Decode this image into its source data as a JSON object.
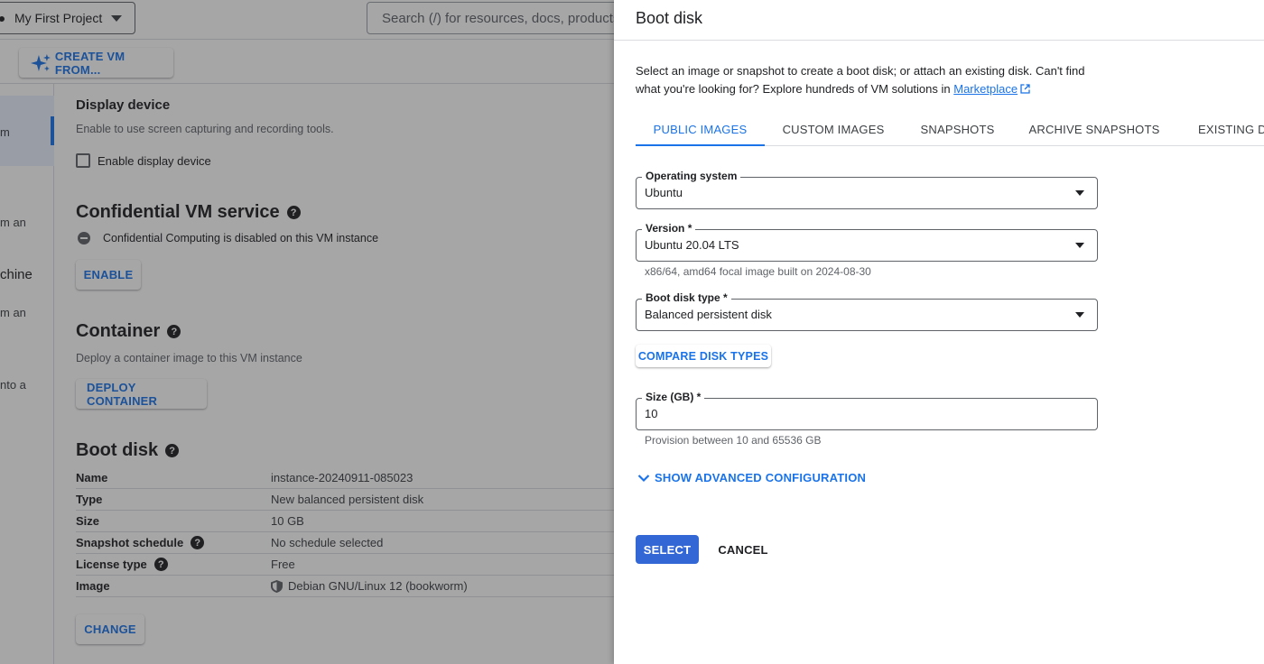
{
  "topbar": {
    "project_name": "My First Project",
    "search_placeholder": "Search (/) for resources, docs, products, and more"
  },
  "toolbar": {
    "create_vm_label": "CREATE VM FROM..."
  },
  "leftnav": {
    "fragments": [
      "m",
      "m an",
      "chine",
      "m an",
      "nto a"
    ]
  },
  "display_device": {
    "title": "Display device",
    "description": "Enable to use screen capturing and recording tools.",
    "checkbox_label": "Enable display device"
  },
  "confidential_vm": {
    "title": "Confidential VM service",
    "status": "Confidential Computing is disabled on this VM instance",
    "enable_label": "ENABLE"
  },
  "container": {
    "title": "Container",
    "description": "Deploy a container image to this VM instance",
    "deploy_label": "DEPLOY CONTAINER"
  },
  "boot_disk_summary": {
    "title": "Boot disk",
    "rows": [
      {
        "key": "Name",
        "value": "instance-20240911-085023"
      },
      {
        "key": "Type",
        "value": "New balanced persistent disk"
      },
      {
        "key": "Size",
        "value": "10 GB"
      },
      {
        "key": "Snapshot schedule",
        "value": "No schedule selected"
      },
      {
        "key": "License type",
        "value": "Free"
      },
      {
        "key": "Image",
        "value": "Debian GNU/Linux 12 (bookworm)"
      }
    ],
    "change_label": "CHANGE"
  },
  "panel": {
    "title": "Boot disk",
    "description_text": "Select an image or snapshot to create a boot disk; or attach an existing disk. Can't find what you're looking for? Explore hundreds of VM solutions in",
    "marketplace_link": "Marketplace",
    "tabs": [
      {
        "label": "PUBLIC IMAGES",
        "active": true
      },
      {
        "label": "CUSTOM IMAGES",
        "active": false
      },
      {
        "label": "SNAPSHOTS",
        "active": false
      },
      {
        "label": "ARCHIVE SNAPSHOTS",
        "active": false
      },
      {
        "label": "EXISTING DI",
        "active": false
      }
    ],
    "os": {
      "label": "Operating system",
      "value": "Ubuntu"
    },
    "version": {
      "label": "Version *",
      "value": "Ubuntu 20.04 LTS",
      "hint": "x86/64, amd64 focal image built on 2024-08-30"
    },
    "disk_type": {
      "label": "Boot disk type *",
      "value": "Balanced persistent disk"
    },
    "compare_label": "COMPARE DISK TYPES",
    "size": {
      "label": "Size (GB) *",
      "value": "10",
      "hint": "Provision between 10 and 65536 GB"
    },
    "advanced_label": "SHOW ADVANCED CONFIGURATION",
    "select_label": "SELECT",
    "cancel_label": "CANCEL"
  },
  "colors": {
    "accent": "#1a73e8",
    "primary_button": "#3367d6",
    "scrim": "rgba(32,33,36,0.4)"
  }
}
